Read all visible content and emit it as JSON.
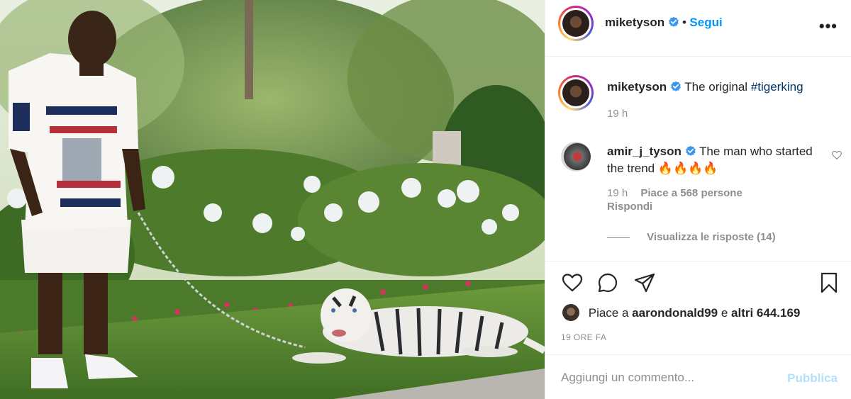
{
  "post": {
    "author": "miketyson",
    "follow_label": "Segui",
    "dot": "•",
    "more_label": "•••"
  },
  "caption": {
    "author": "miketyson",
    "text": "The original",
    "hashtag": "#tigerking",
    "time": "19 h"
  },
  "comment": {
    "author": "amir_j_tyson",
    "text": "The man who started the trend",
    "emojis": "🔥🔥🔥🔥",
    "time": "19 h",
    "likes": "Piace a 568 persone",
    "reply_label": "Rispondi",
    "view_replies": "Visualizza le risposte (14)"
  },
  "likes": {
    "prefix": "Piace a",
    "user": "aarondonald99",
    "middle": "e",
    "others": "altri 644.169"
  },
  "timestamp": "19 ORE FA",
  "composer": {
    "placeholder": "Aggiungi un commento...",
    "publish_label": "Pubblica"
  },
  "icons": {
    "verified": "verified-badge-icon",
    "like": "heart-icon",
    "comment": "comment-icon",
    "share": "paper-plane-icon",
    "save": "bookmark-icon",
    "more": "more-options-icon"
  },
  "colors": {
    "accent": "#0095f6",
    "hashtag": "#00376b",
    "muted": "#8e8e8e",
    "publish_disabled": "#b2dffc"
  }
}
